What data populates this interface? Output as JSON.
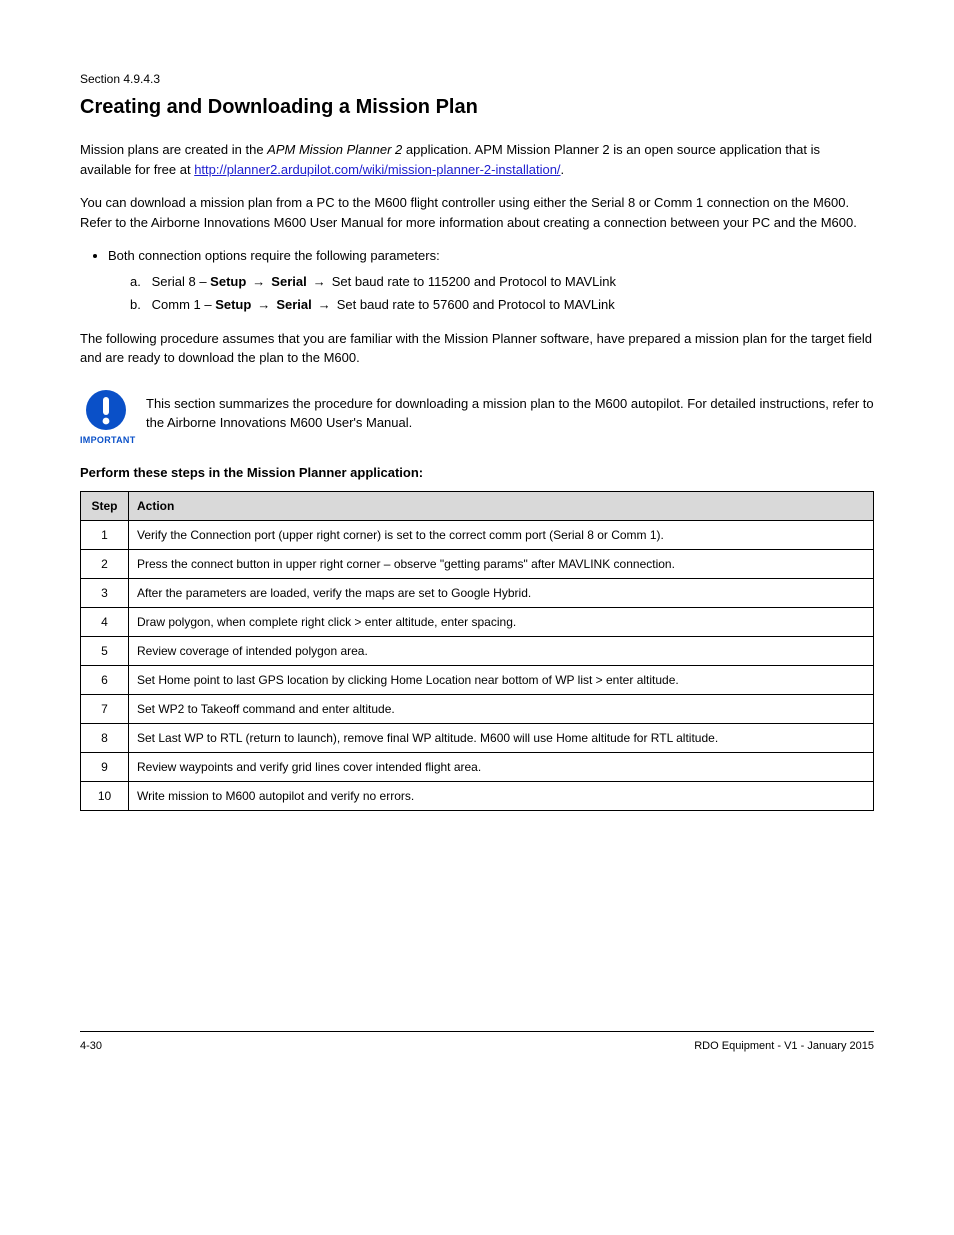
{
  "section": {
    "label": "Section 4.9.4.3"
  },
  "heading": "Creating and Downloading a Mission Plan",
  "intro": {
    "p1_prefix": "Mission plans are created in the ",
    "p1_em": "APM Mission Planner 2",
    "p1_suffix": " application. APM Mission Planner 2 is an open source application that is available for free at ",
    "link_text": "http://planner2.ardupilot.com/wiki/mission-planner-2-installation/",
    "p1_tail": ".",
    "p2": "You can download a mission plan from a PC to the M600 flight controller using either the Serial 8 or Comm 1 connection on the M600. Refer to the Airborne Innovations M600 User Manual for more information about creating a connection between your PC and the M600.",
    "options_lead": "Both connection options require the following parameters:",
    "opt_a_label": "a.",
    "opt_a_prefix": "Serial 8 – ",
    "opt_a_step1": "Setup",
    "opt_a_step2": "Serial",
    "opt_a_step3": "Set baud rate to 115200 and Protocol to MAVLink",
    "opt_b_label": "b.",
    "opt_b_prefix": "Comm 1 – ",
    "opt_b_step1": "Setup",
    "opt_b_step2": "Serial",
    "opt_b_step3": "Set baud rate to 57600 and Protocol to MAVLink",
    "p3": "The following procedure assumes that you are familiar with the Mission Planner software, have prepared a mission plan for the target field and are ready to download the plan to the M600."
  },
  "important": {
    "label": "IMPORTANT",
    "body": "This section summarizes the procedure for downloading a mission plan to the M600 autopilot. For detailed instructions, refer to the Airborne Innovations M600 User's Manual."
  },
  "steps_label": "Perform these steps in the Mission Planner application:",
  "table": {
    "headers": [
      "Step",
      "Action"
    ],
    "rows": [
      [
        "1",
        "Verify the Connection port (upper right corner) is set to the correct comm port (Serial 8 or Comm 1)."
      ],
      [
        "2",
        "Press the connect button in upper right corner – observe \"getting params\" after MAVLINK connection."
      ],
      [
        "3",
        "After the parameters are loaded, verify the maps are set to Google Hybrid."
      ],
      [
        "4",
        "Draw polygon, when complete right click > enter altitude, enter spacing."
      ],
      [
        "5",
        "Review coverage of intended polygon area."
      ],
      [
        "6",
        "Set Home point to last GPS location by clicking Home Location near bottom of WP list > enter altitude."
      ],
      [
        "7",
        "Set WP2 to Takeoff command and enter altitude."
      ],
      [
        "8",
        "Set Last WP to RTL (return to launch), remove final WP altitude. M600 will use Home altitude for RTL altitude."
      ],
      [
        "9",
        "Review waypoints and verify grid lines cover intended flight area."
      ],
      [
        "10",
        "Write mission to M600 autopilot and verify no errors."
      ]
    ]
  },
  "footer": {
    "left": "4-30",
    "right": "RDO Equipment - V1 - January 2015"
  }
}
